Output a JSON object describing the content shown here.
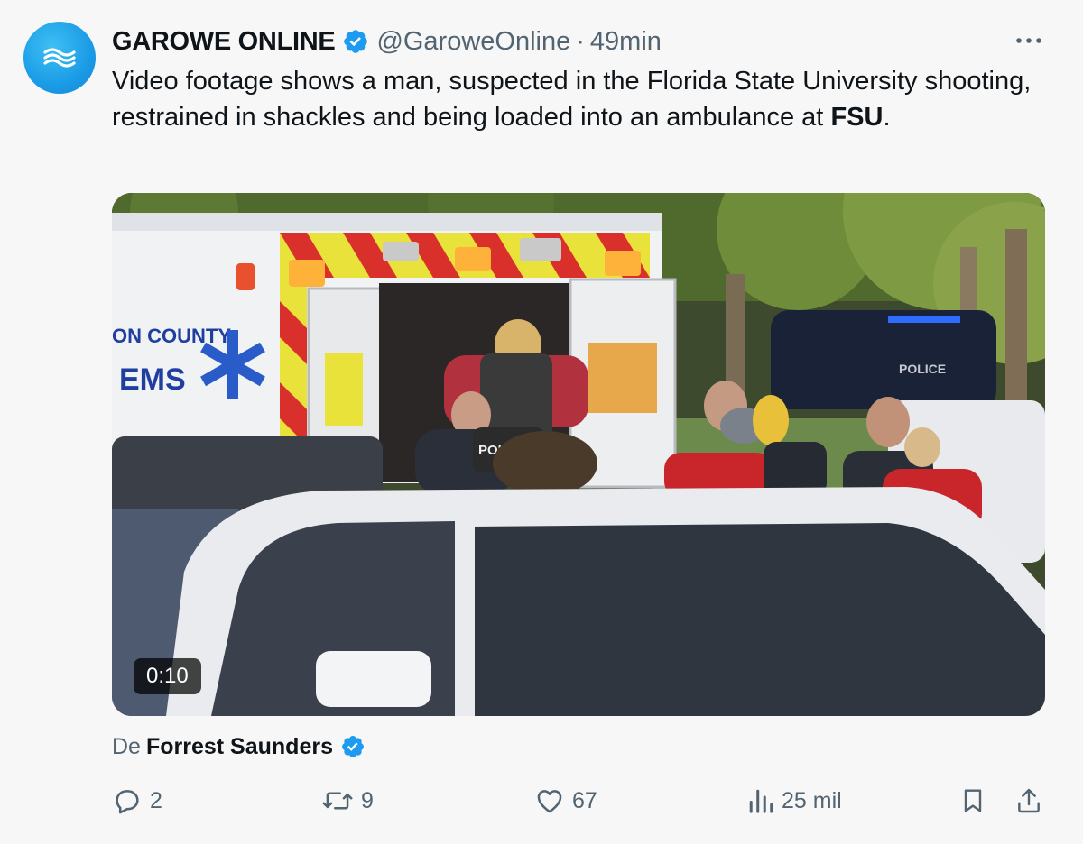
{
  "tweet": {
    "display_name": "GAROWE ONLINE",
    "handle": "@GaroweOnline",
    "separator": "·",
    "time": "49min",
    "text_before": "Video footage shows a man, suspected in the Florida State University shooting, restrained in shackles and being loaded into an ambulance at ",
    "text_bold": "FSU",
    "text_after": "."
  },
  "media": {
    "duration": "0:10",
    "vehicle_text": {
      "county": "ON COUNTY",
      "ems": "EMS",
      "police_vest": "POLICE",
      "police_car": "POLICE"
    }
  },
  "attribution": {
    "prefix": "De",
    "name": "Forrest Saunders"
  },
  "actions": {
    "replies": "2",
    "reposts": "9",
    "likes": "67",
    "views": "25 mil"
  },
  "icons": [
    "avatar-logo-icon",
    "verified-icon",
    "more-icon",
    "reply-icon",
    "repost-icon",
    "like-icon",
    "views-icon",
    "bookmark-icon",
    "share-icon"
  ],
  "colors": {
    "verified": "#1d9bf0",
    "muted": "#536471",
    "text": "#0f1419",
    "background": "#f7f7f7"
  }
}
